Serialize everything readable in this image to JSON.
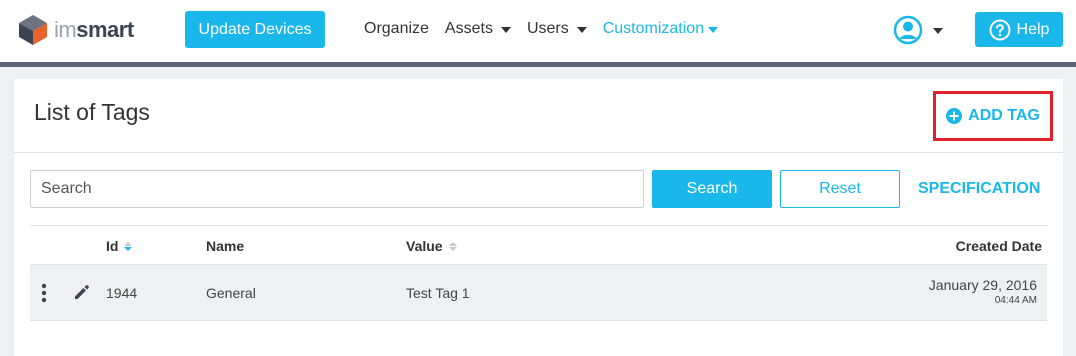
{
  "header": {
    "logo": {
      "prefix": "im",
      "suffix": "smart",
      "icon": "cube-logo-icon"
    },
    "update_button": "Update Devices",
    "nav": [
      {
        "label": "Organize",
        "dropdown": false,
        "active": false
      },
      {
        "label": "Assets",
        "dropdown": true,
        "active": false
      },
      {
        "label": "Users",
        "dropdown": true,
        "active": false
      },
      {
        "label": "Customization",
        "dropdown": true,
        "active": true
      }
    ],
    "user_icon": "user-circle-icon",
    "help_button": "Help"
  },
  "page": {
    "title": "List of Tags",
    "add_tag": "ADD TAG"
  },
  "search": {
    "placeholder": "Search",
    "value": "",
    "search_button": "Search",
    "reset_button": "Reset",
    "specification_link": "SPECIFICATION"
  },
  "table": {
    "columns": {
      "id": "Id",
      "name": "Name",
      "value": "Value",
      "created": "Created Date"
    },
    "rows": [
      {
        "id": "1944",
        "name": "General",
        "value": "Test Tag 1",
        "date": "January 29, 2016",
        "time": "04:44 AM"
      }
    ]
  },
  "colors": {
    "accent": "#1ab7ea",
    "highlight": "#e0202a",
    "nav_border": "#58657a"
  }
}
